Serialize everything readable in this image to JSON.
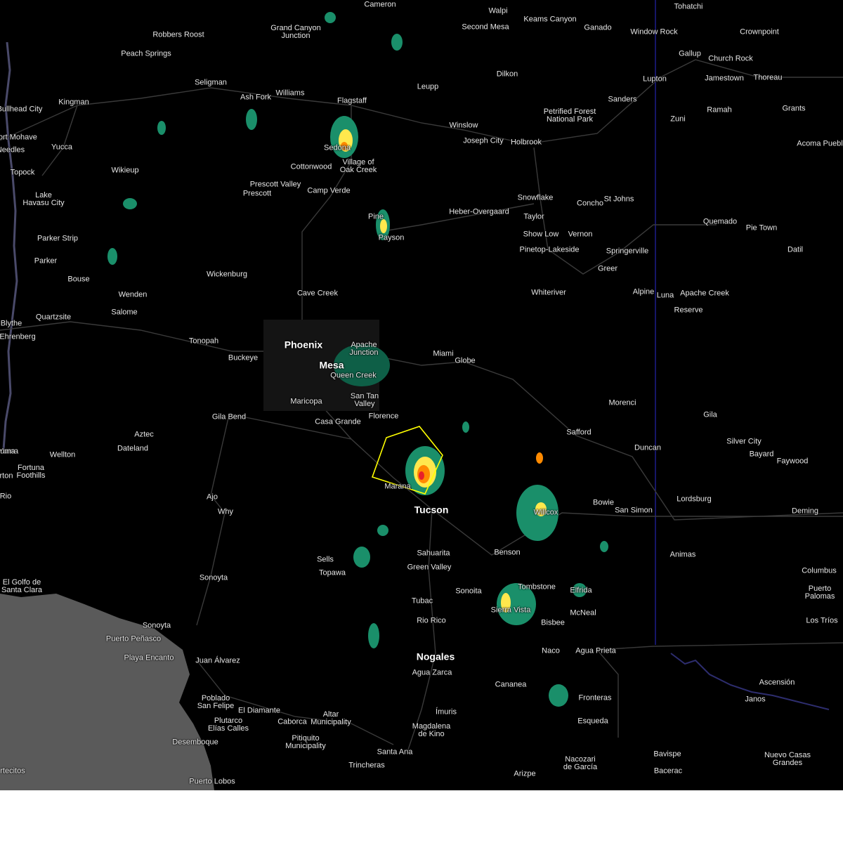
{
  "colors": {
    "background": "#000000",
    "ocean": "#5a5a5a",
    "roads": "#3a3a3a",
    "state_border": "#2b2bd1",
    "warning_polygon": "#ffff00",
    "radar_green": "#1a8f6a",
    "radar_yellow": "#ffe84d",
    "radar_orange": "#ff8a00",
    "radar_red": "#e8202a"
  },
  "places": [
    {
      "name": "Cameron"
    },
    {
      "name": "Walpi"
    },
    {
      "name": "Keams Canyon"
    },
    {
      "name": "Tohatchi"
    },
    {
      "name": "Robbers Roost"
    },
    {
      "name": "Grand Canyon\nJunction"
    },
    {
      "name": "Second Mesa"
    },
    {
      "name": "Ganado"
    },
    {
      "name": "Window Rock"
    },
    {
      "name": "Crownpoint"
    },
    {
      "name": "Peach Springs"
    },
    {
      "name": "Gallup"
    },
    {
      "name": "Church Rock"
    },
    {
      "name": "Dilkon"
    },
    {
      "name": "Jamestown"
    },
    {
      "name": "Thoreau"
    },
    {
      "name": "Lupton"
    },
    {
      "name": "Seligman"
    },
    {
      "name": "Ash Fork"
    },
    {
      "name": "Williams"
    },
    {
      "name": "Leupp"
    },
    {
      "name": "Kingman"
    },
    {
      "name": "Flagstaff"
    },
    {
      "name": "Sanders"
    },
    {
      "name": "Bullhead City"
    },
    {
      "name": "Petrified Forest\nNational Park"
    },
    {
      "name": "Ramah"
    },
    {
      "name": "Grants"
    },
    {
      "name": "Zuni"
    },
    {
      "name": "Winslow"
    },
    {
      "name": "Fort Mohave"
    },
    {
      "name": "Joseph City"
    },
    {
      "name": "Holbrook"
    },
    {
      "name": "Needles"
    },
    {
      "name": "Yucca"
    },
    {
      "name": "Acoma Pueblo"
    },
    {
      "name": "Sedona"
    },
    {
      "name": "Topock"
    },
    {
      "name": "Wikieup"
    },
    {
      "name": "Cottonwood"
    },
    {
      "name": "Village of\nOak Creek"
    },
    {
      "name": "Lake\nHavasu City"
    },
    {
      "name": "Prescott Valley"
    },
    {
      "name": "Prescott"
    },
    {
      "name": "Camp Verde"
    },
    {
      "name": "Snowflake"
    },
    {
      "name": "Concho"
    },
    {
      "name": "St Johns"
    },
    {
      "name": "Taylor"
    },
    {
      "name": "Heber-Overgaard"
    },
    {
      "name": "Pine"
    },
    {
      "name": "Payson"
    },
    {
      "name": "Quemado"
    },
    {
      "name": "Pie Town"
    },
    {
      "name": "Parker Strip"
    },
    {
      "name": "Show Low"
    },
    {
      "name": "Vernon"
    },
    {
      "name": "Pinetop-Lakeside"
    },
    {
      "name": "Springerville"
    },
    {
      "name": "Datil"
    },
    {
      "name": "Parker"
    },
    {
      "name": "Greer"
    },
    {
      "name": "Wickenburg"
    },
    {
      "name": "Bouse"
    },
    {
      "name": "Wenden"
    },
    {
      "name": "Cave Creek"
    },
    {
      "name": "Whiteriver"
    },
    {
      "name": "Alpine"
    },
    {
      "name": "Luna"
    },
    {
      "name": "Apache Creek"
    },
    {
      "name": "Salome"
    },
    {
      "name": "Reserve"
    },
    {
      "name": "Quartzsite"
    },
    {
      "name": "Blythe"
    },
    {
      "name": "Ehrenberg"
    },
    {
      "name": "Tonopah"
    },
    {
      "name": "Phoenix"
    },
    {
      "name": "Apache\nJunction"
    },
    {
      "name": "Buckeye"
    },
    {
      "name": "Miami"
    },
    {
      "name": "Globe"
    },
    {
      "name": "Mesa"
    },
    {
      "name": "Queen Creek"
    },
    {
      "name": "San Tan\nValley"
    },
    {
      "name": "Maricopa"
    },
    {
      "name": "Morenci"
    },
    {
      "name": "Florence"
    },
    {
      "name": "Casa Grande"
    },
    {
      "name": "Gila Bend"
    },
    {
      "name": "Gila"
    },
    {
      "name": "Aztec"
    },
    {
      "name": "Safford"
    },
    {
      "name": "Silver City"
    },
    {
      "name": "Dateland"
    },
    {
      "name": "Duncan"
    },
    {
      "name": "Bayard"
    },
    {
      "name": "Faywood"
    },
    {
      "name": "Yuma"
    },
    {
      "name": "Wellton"
    },
    {
      "name": "Fortuna\nFoothills"
    },
    {
      "name": "Marana"
    },
    {
      "name": "Lordsburg"
    },
    {
      "name": "Ajo"
    },
    {
      "name": "Bowie"
    },
    {
      "name": "San Simon"
    },
    {
      "name": "Tucson"
    },
    {
      "name": "Why"
    },
    {
      "name": "Willcox"
    },
    {
      "name": "Deming"
    },
    {
      "name": "Sahuarita"
    },
    {
      "name": "Benson"
    },
    {
      "name": "Animas"
    },
    {
      "name": "Sells"
    },
    {
      "name": "Green Valley"
    },
    {
      "name": "Topawa"
    },
    {
      "name": "Columbus"
    },
    {
      "name": "Sonoyta"
    },
    {
      "name": "El Golfo de\nSanta Clara"
    },
    {
      "name": "Sonoita"
    },
    {
      "name": "Tombstone"
    },
    {
      "name": "Elfrida"
    },
    {
      "name": "Puerto\nPalomas"
    },
    {
      "name": "Tubac"
    },
    {
      "name": "Sierra Vista"
    },
    {
      "name": "McNeal"
    },
    {
      "name": "Rio Rico"
    },
    {
      "name": "Bisbee"
    },
    {
      "name": "Los Tríos"
    },
    {
      "name": "Sonoyta"
    },
    {
      "name": "Puerto Peñasco"
    },
    {
      "name": "Naco"
    },
    {
      "name": "Agua Prieta"
    },
    {
      "name": "Playa Encanto"
    },
    {
      "name": "Nogales"
    },
    {
      "name": "Juan Álvarez"
    },
    {
      "name": "Agua Zarca"
    },
    {
      "name": "Ascensión"
    },
    {
      "name": "Cananea"
    },
    {
      "name": "Poblado\nSan Felipe"
    },
    {
      "name": "El Diamante"
    },
    {
      "name": "Fronteras"
    },
    {
      "name": "Janos"
    },
    {
      "name": "Plutarco\nElías Calles"
    },
    {
      "name": "Caborca"
    },
    {
      "name": "Altar\nMunicipality"
    },
    {
      "name": "Ímuris"
    },
    {
      "name": "Esqueda"
    },
    {
      "name": "Desemboque"
    },
    {
      "name": "Pitiquito\nMunicipality"
    },
    {
      "name": "Magdalena\nde Kino"
    },
    {
      "name": "Bavispe"
    },
    {
      "name": "Nuevo Casas\nGrandes"
    },
    {
      "name": "Santa Ana"
    },
    {
      "name": "Nacozari\nde García"
    },
    {
      "name": "Trincheras"
    },
    {
      "name": "Bacerac"
    },
    {
      "name": "Arizpe"
    },
    {
      "name": "Puerto Lobos"
    },
    {
      "name": "Rio"
    },
    {
      "name": "rton"
    },
    {
      "name": "uma"
    },
    {
      "name": "rtecitos"
    }
  ]
}
